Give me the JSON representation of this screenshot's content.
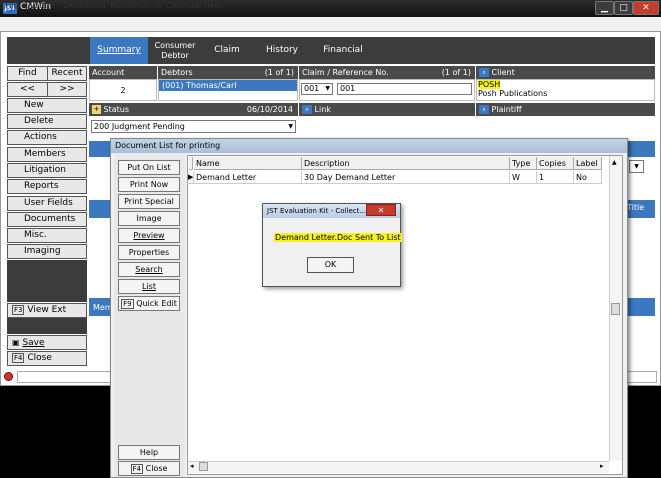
{
  "window": {
    "app_icon_text": "JST",
    "title": "CMWin",
    "minimize": "▁",
    "maximize": "□",
    "close": "✕"
  },
  "menu": [
    "File",
    "System",
    "Definitions",
    "Maintenance",
    "Calendar",
    "Help"
  ],
  "nav_tabs": {
    "summary": "Summary",
    "consumer_line1": "Consumer",
    "consumer_line2": "Debtor",
    "claim": "Claim",
    "history": "History",
    "financial": "Financial"
  },
  "sidebar": {
    "find": "Find",
    "recent": "Recent",
    "prev": "<<",
    "next": ">>",
    "items": [
      "New",
      "Delete",
      "Actions",
      "Members",
      "Litigation",
      "Reports",
      "User Fields",
      "Documents",
      "Misc.",
      "Imaging"
    ],
    "view_ext": "View Ext",
    "view_ext_key": "F3",
    "save": "Save",
    "close": "Close",
    "close_key": "F4"
  },
  "summary": {
    "account_label": "Account",
    "account_value": "2",
    "debtors_label": "Debtors",
    "debtors_count": "(1 of 1)",
    "debtor_value": "(001) Thomas/Carl",
    "claim_label": "Claim / Reference No.",
    "claim_count": "(1 of 1)",
    "claim_select": "001",
    "claim_value": "001",
    "client_label": "Client",
    "client_code": "POSH",
    "client_name": "Posh Publications",
    "status_label": "Status",
    "status_date": "06/10/2014",
    "status_value": "200   Judgment Pending",
    "link_label": "Link",
    "plaintiff_label": "Plaintiff",
    "title_label": "Title",
    "members_label": "Mem"
  },
  "doc_dialog": {
    "title": "Document List for printing",
    "buttons": [
      "Put On List",
      "Print Now",
      "Print Special",
      "Image",
      "Preview",
      "Properties",
      "Search",
      "List"
    ],
    "quick_edit_key": "F9",
    "quick_edit": "Quick Edit",
    "help": "Help",
    "close_key": "F4",
    "close": "Close",
    "columns": [
      "Name",
      "Description",
      "Type",
      "Copies",
      "Label"
    ],
    "rows": [
      {
        "name": "Demand Letter",
        "description": "30 Day Demand Letter",
        "type": "W",
        "copies": "1",
        "label": "No"
      }
    ]
  },
  "popup": {
    "title": "JST Evaluation Kit - Collect...",
    "close": "✕",
    "message": "Demand Letter.Doc Sent To List",
    "ok": "OK"
  }
}
